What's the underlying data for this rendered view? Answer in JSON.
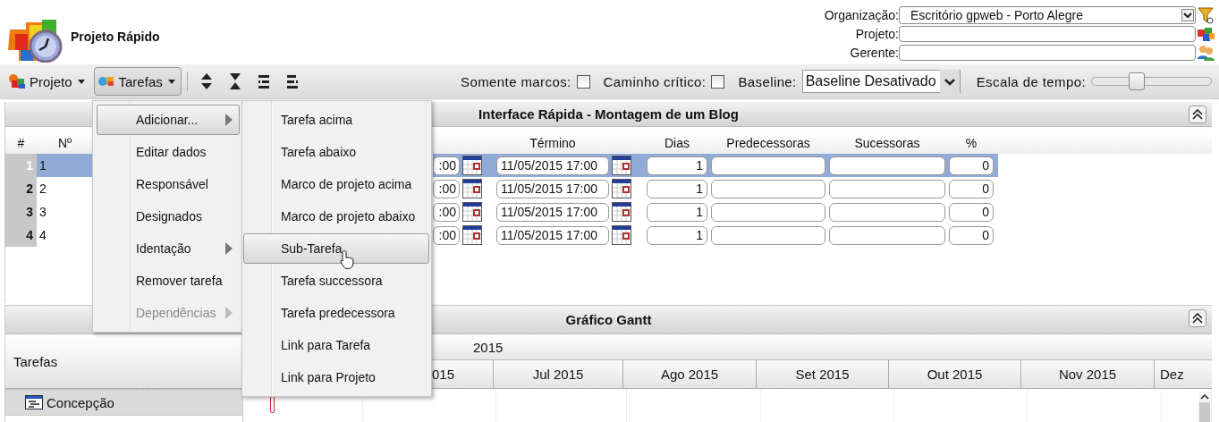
{
  "app": {
    "title": "Projeto Rápido"
  },
  "filters": [
    {
      "kind": "select",
      "label": "Organização:",
      "value": "Escritório gpweb - Porto Alegre"
    },
    {
      "kind": "text",
      "label": "Projeto:"
    },
    {
      "kind": "text",
      "label": "Gerente:"
    }
  ],
  "toolbar": {
    "menus": [
      {
        "label": "Projeto",
        "selected": false
      },
      {
        "label": "Tarefas",
        "selected": true
      }
    ],
    "options": [
      {
        "kind": "checkbox",
        "label": "Somente marcos:",
        "checked": false
      },
      {
        "kind": "checkbox",
        "label": "Caminho crítico:",
        "checked": false
      },
      {
        "kind": "select",
        "label": "Baseline:",
        "value": "Baseline Desativado"
      },
      {
        "kind": "slider",
        "label": "Escala de tempo:",
        "level": 0.36
      }
    ]
  },
  "task_panel": {
    "title": "Interface Rápida - Montagem de um Blog",
    "columns": {
      "index": "#",
      "number": "Nº",
      "end": "Término",
      "days": "Dias",
      "predecessors": "Predecessoras",
      "successors": "Sucessoras",
      "percent": "%"
    },
    "rows": [
      {
        "index": "1",
        "number": "1",
        "start": ":00",
        "end": "11/05/2015 17:00",
        "days": "1",
        "percent": "0",
        "selected": true
      },
      {
        "index": "2",
        "number": "2",
        "start": ":00",
        "end": "11/05/2015 17:00",
        "days": "1",
        "percent": "0",
        "selected": false
      },
      {
        "index": "3",
        "number": "3",
        "start": ":00",
        "end": "11/05/2015 17:00",
        "days": "1",
        "percent": "0",
        "selected": false
      },
      {
        "index": "4",
        "number": "4",
        "start": ":00",
        "end": "11/05/2015 17:00",
        "days": "1",
        "percent": "0",
        "selected": false
      }
    ]
  },
  "gantt": {
    "title": "Gráfico Gantt",
    "tasks_header": "Tarefas",
    "year": "2015",
    "months": [
      "015",
      "Jul 2015",
      "Ago 2015",
      "Set 2015",
      "Out 2015",
      "Nov 2015",
      "Dez"
    ],
    "tasks": [
      {
        "name": "Concepção"
      }
    ]
  },
  "menu": {
    "items": [
      {
        "label": "Adicionar...",
        "selected": true,
        "submenu": true,
        "disabled": false
      },
      {
        "label": "Editar dados",
        "selected": false,
        "submenu": false,
        "disabled": false
      },
      {
        "label": "Responsável",
        "selected": false,
        "submenu": false,
        "disabled": false
      },
      {
        "label": "Designados",
        "selected": false,
        "submenu": false,
        "disabled": false
      },
      {
        "label": "Identação",
        "selected": false,
        "submenu": true,
        "disabled": false
      },
      {
        "label": "Remover tarefa",
        "selected": false,
        "submenu": false,
        "disabled": false
      },
      {
        "label": "Dependências",
        "selected": false,
        "submenu": true,
        "disabled": true
      }
    ],
    "submenu": [
      {
        "label": "Tarefa acima",
        "selected": false
      },
      {
        "label": "Tarefa abaixo",
        "selected": false
      },
      {
        "label": "Marco de projeto acima",
        "selected": false
      },
      {
        "label": "Marco de projeto abaixo",
        "selected": false
      },
      {
        "label": "Sub-Tarefa",
        "selected": true
      },
      {
        "label": "Tarefa successora",
        "selected": false
      },
      {
        "label": "Tarefa predecessora",
        "selected": false
      },
      {
        "label": "Link para Tarefa",
        "selected": false
      },
      {
        "label": "Link para Projeto",
        "selected": false
      }
    ]
  }
}
